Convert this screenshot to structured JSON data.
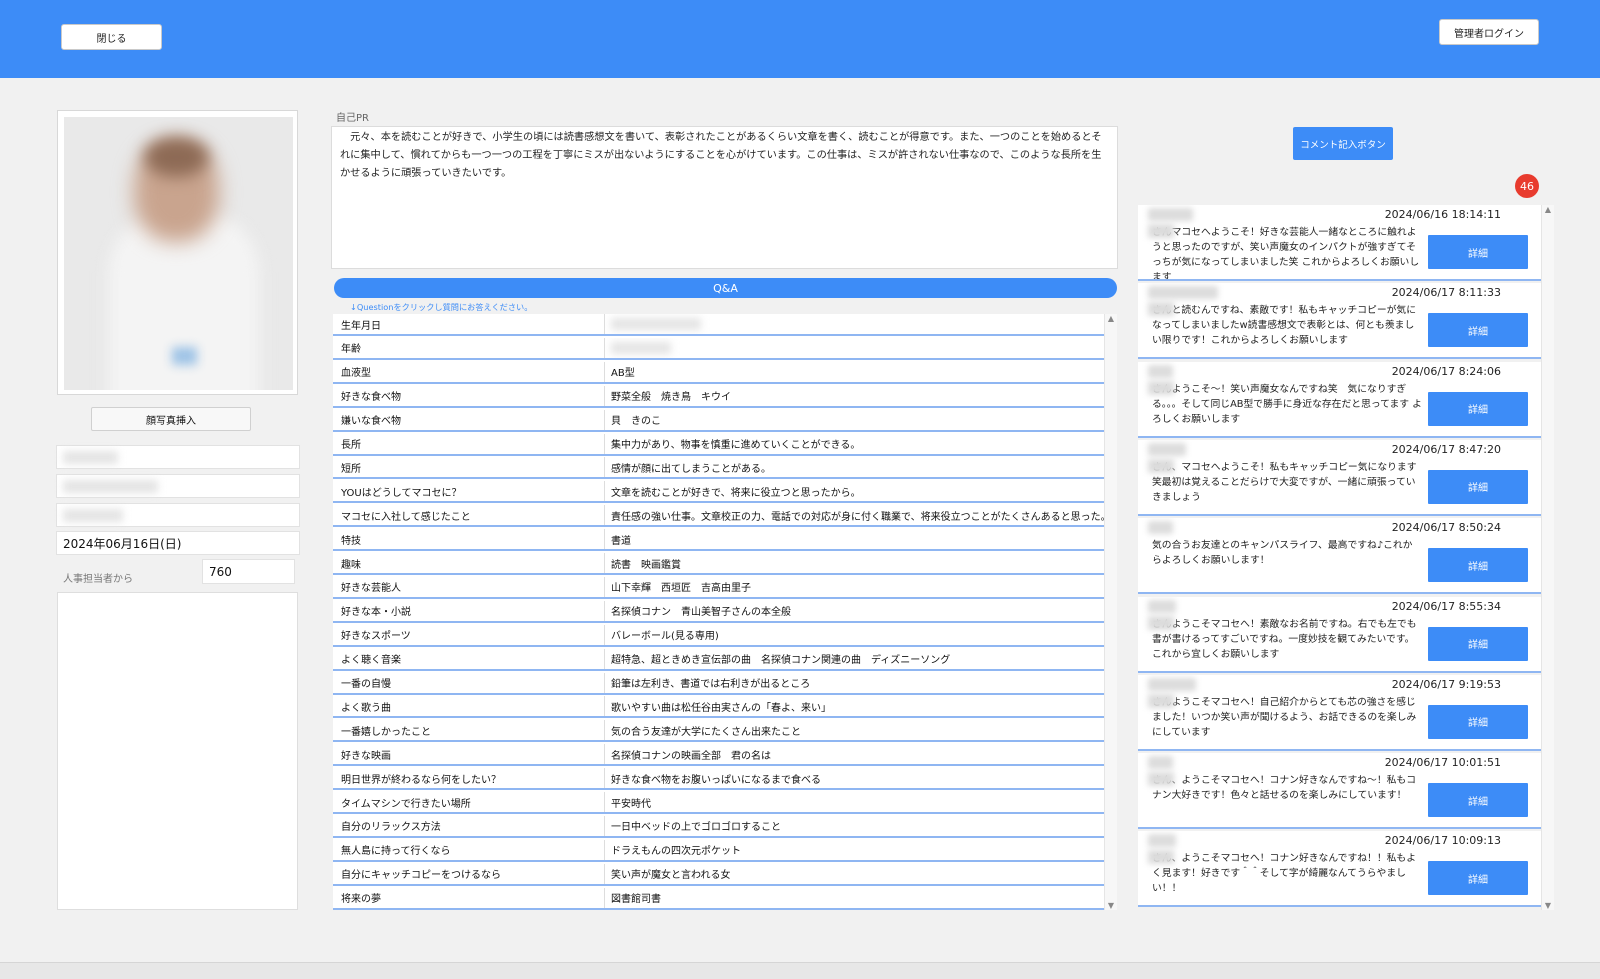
{
  "header": {
    "close_label": "閉じる",
    "admin_login_label": "管理者ログイン"
  },
  "profile": {
    "insert_photo_label": "顔写真挿入",
    "date_value": "2024年06月16日(日)",
    "hr_label": "人事担当者から",
    "hr_value": "760"
  },
  "pr": {
    "label": "自己PR",
    "text": "　元々、本を読むことが好きで、小学生の頃には読書感想文を書いて、表彰されたことがあるくらい文章を書く、読むことが得意です。また、一つのことを始めるとそれに集中して、慣れてからも一つ一つの工程を丁寧にミスが出ないようにすることを心がけています。この仕事は、ミスが許されない仕事なので、このような長所を生かせるように頑張っていきたいです。"
  },
  "qa": {
    "title": "Q&A",
    "hint": "↓Questionをクリックし質問にお答えください。",
    "rows": [
      {
        "q": "生年月日",
        "a": ""
      },
      {
        "q": "年齢",
        "a": ""
      },
      {
        "q": "血液型",
        "a": "AB型"
      },
      {
        "q": "好きな食べ物",
        "a": "野菜全般　焼き鳥　キウイ"
      },
      {
        "q": "嫌いな食べ物",
        "a": "貝　きのこ"
      },
      {
        "q": "長所",
        "a": "集中力があり、物事を慎重に進めていくことができる。"
      },
      {
        "q": "短所",
        "a": "感情が顔に出てしまうことがある。"
      },
      {
        "q": "YOUはどうしてマコセに？",
        "a": "文章を読むことが好きで、将来に役立つと思ったから。"
      },
      {
        "q": "マコセに入社して感じたこと",
        "a": "責任感の強い仕事。文章校正の力、電話での対応が身に付く職業で、将来役立つことがたくさんあると思った。"
      },
      {
        "q": "特技",
        "a": "書道"
      },
      {
        "q": "趣味",
        "a": "読書　映画鑑賞"
      },
      {
        "q": "好きな芸能人",
        "a": "山下幸輝　西垣匠　吉高由里子"
      },
      {
        "q": "好きな本・小説",
        "a": "名探偵コナン　青山美智子さんの本全般"
      },
      {
        "q": "好きなスポーツ",
        "a": "バレーボール(見る専用)"
      },
      {
        "q": "よく聴く音楽",
        "a": "超特急、超ときめき宣伝部の曲　名探偵コナン関連の曲　ディズニーソング"
      },
      {
        "q": "一番の自慢",
        "a": "鉛筆は左利き、書道では右利きが出るところ"
      },
      {
        "q": "よく歌う曲",
        "a": "歌いやすい曲は松任谷由実さんの「春よ、来い」"
      },
      {
        "q": "一番嬉しかったこと",
        "a": "気の合う友達が大学にたくさん出来たこと"
      },
      {
        "q": "好きな映画",
        "a": "名探偵コナンの映画全部　君の名は"
      },
      {
        "q": "明日世界が終わるなら何をしたい？",
        "a": "好きな食べ物をお腹いっぱいになるまで食べる"
      },
      {
        "q": "タイムマシンで行きたい場所",
        "a": "平安時代"
      },
      {
        "q": "自分のリラックス方法",
        "a": "一日中ベッドの上でゴロゴロすること"
      },
      {
        "q": "無人島に持って行くなら",
        "a": "ドラえもんの四次元ポケット"
      },
      {
        "q": "自分にキャッチコピーをつけるなら",
        "a": "笑い声が魔女と言われる女"
      },
      {
        "q": "将来の夢",
        "a": "図書館司書"
      }
    ]
  },
  "comments": {
    "button_label": "コメント記入ボタン",
    "badge_count": "46",
    "detail_label": "詳細",
    "items": [
      {
        "date": "2024/06/16 18:14:11",
        "text": "さんマコセへようこそ！好きな芸能人一緒なところに触れようと思ったのですが、笑い声魔女のインパクトが強すぎてそっちが気になってしまいました笑 これからよろしくお願いします"
      },
      {
        "date": "2024/06/17 8:11:33",
        "text": "さんと読むんですね、素敵です！私もキャッチコピーが気になってしまいましたw読書感想文で表彰とは、何とも羨ましい限りです！これからよろしくお願いします"
      },
      {
        "date": "2024/06/17 8:24:06",
        "text": "さんようこそ～！笑い声魔女なんですね笑　気になりすぎる。。。そして同じAB型で勝手に身近な存在だと思ってます よろしくお願いします"
      },
      {
        "date": "2024/06/17 8:47:20",
        "text": "さん、マコセへようこそ！私もキャッチコピー気になります笑最初は覚えることだらけで大変ですが、一緒に頑張っていきましょう"
      },
      {
        "date": "2024/06/17 8:50:24",
        "text": "気の合うお友達とのキャンパスライフ、最高ですね♪これからよろしくお願いします！"
      },
      {
        "date": "2024/06/17 8:55:34",
        "text": "さんようこそマコセへ！素敵なお名前ですね。右でも左でも書が書けるってすごいですね。一度妙技を観てみたいです。これから宜しくお願いします"
      },
      {
        "date": "2024/06/17 9:19:53",
        "text": "さんようこそマコセへ！自己紹介からとても芯の強さを感じました！いつか笑い声が聞けるよう、お話できるのを楽しみにしています"
      },
      {
        "date": "2024/06/17 10:01:51",
        "text": "さん、ようこそマコセへ！コナン好きなんですね～！私もコナン大好きです！色々と話せるのを楽しみにしています！"
      },
      {
        "date": "2024/06/17 10:09:13",
        "text": "さん、ようこそマコセへ！コナン好きなんですね！！私もよく見ます！好きです＾＾そして字が綺麗なんてうらやましい！！"
      }
    ]
  }
}
